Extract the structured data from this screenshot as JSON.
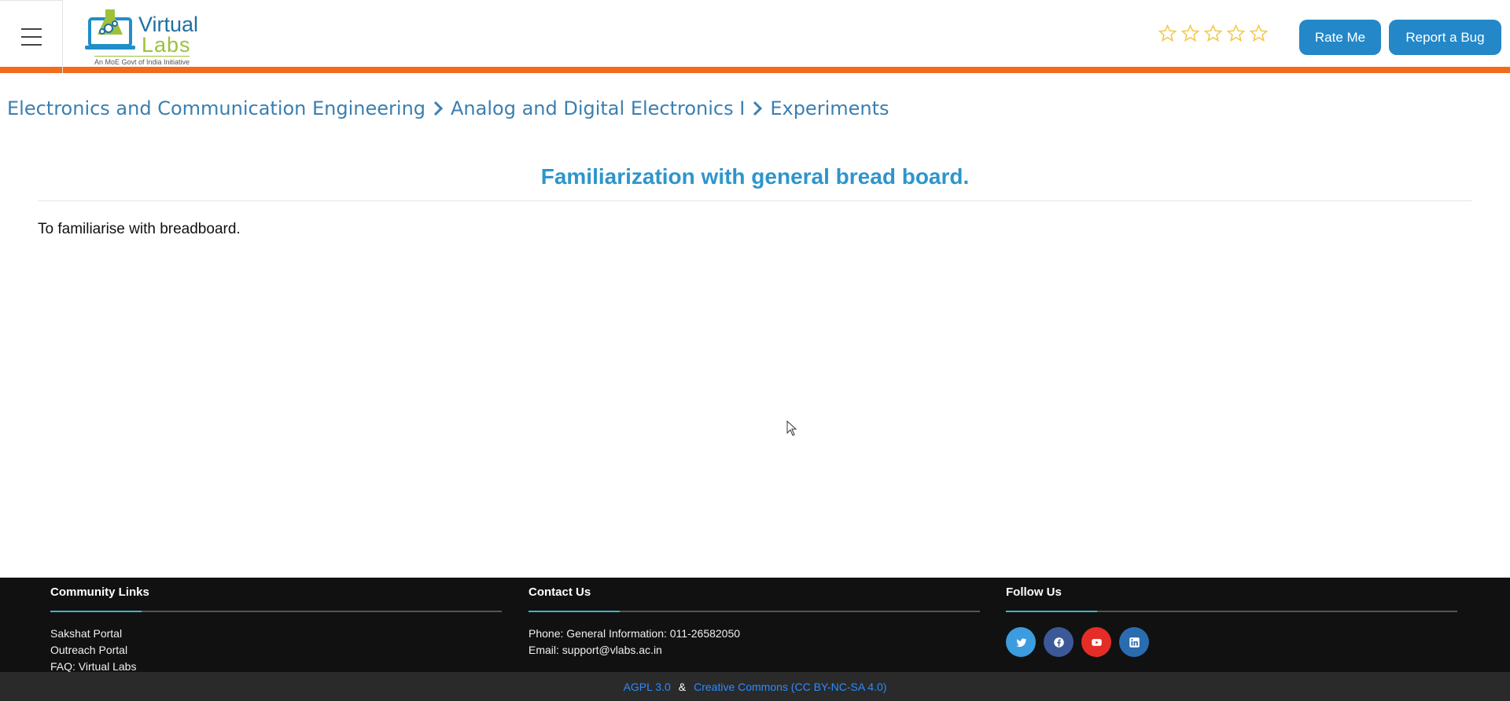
{
  "header": {
    "logo": {
      "word1": "Virtual",
      "word2": "Labs",
      "tagline": "An MoE Govt of India Initiative"
    },
    "rating": {
      "stars_filled": 0,
      "stars_total": 5,
      "star_color": "#f2c94c"
    },
    "rate_button": "Rate Me",
    "bug_button": "Report a Bug",
    "accent_color": "#f26b1a"
  },
  "breadcrumb": {
    "items": [
      "Electronics and Communication Engineering",
      "Analog and Digital Electronics I",
      "Experiments"
    ]
  },
  "main": {
    "title": "Familiarization with general bread board.",
    "aim": "To familiarise with breadboard."
  },
  "footer": {
    "community": {
      "heading": "Community Links",
      "links": [
        "Sakshat Portal",
        "Outreach Portal",
        "FAQ: Virtual Labs"
      ]
    },
    "contact": {
      "heading": "Contact Us",
      "phone": "Phone: General Information: 011-26582050",
      "email": "Email: support@vlabs.ac.in"
    },
    "follow": {
      "heading": "Follow Us",
      "icons": [
        {
          "name": "twitter-icon",
          "color": "#3c9ce0"
        },
        {
          "name": "facebook-icon",
          "color": "#3b5998"
        },
        {
          "name": "youtube-icon",
          "color": "#e52d27"
        },
        {
          "name": "linkedin-icon",
          "color": "#2a6cb0"
        }
      ]
    },
    "license": {
      "agpl": "AGPL 3.0",
      "separator": "&",
      "cc": "Creative Commons (CC BY-NC-SA 4.0)"
    }
  }
}
